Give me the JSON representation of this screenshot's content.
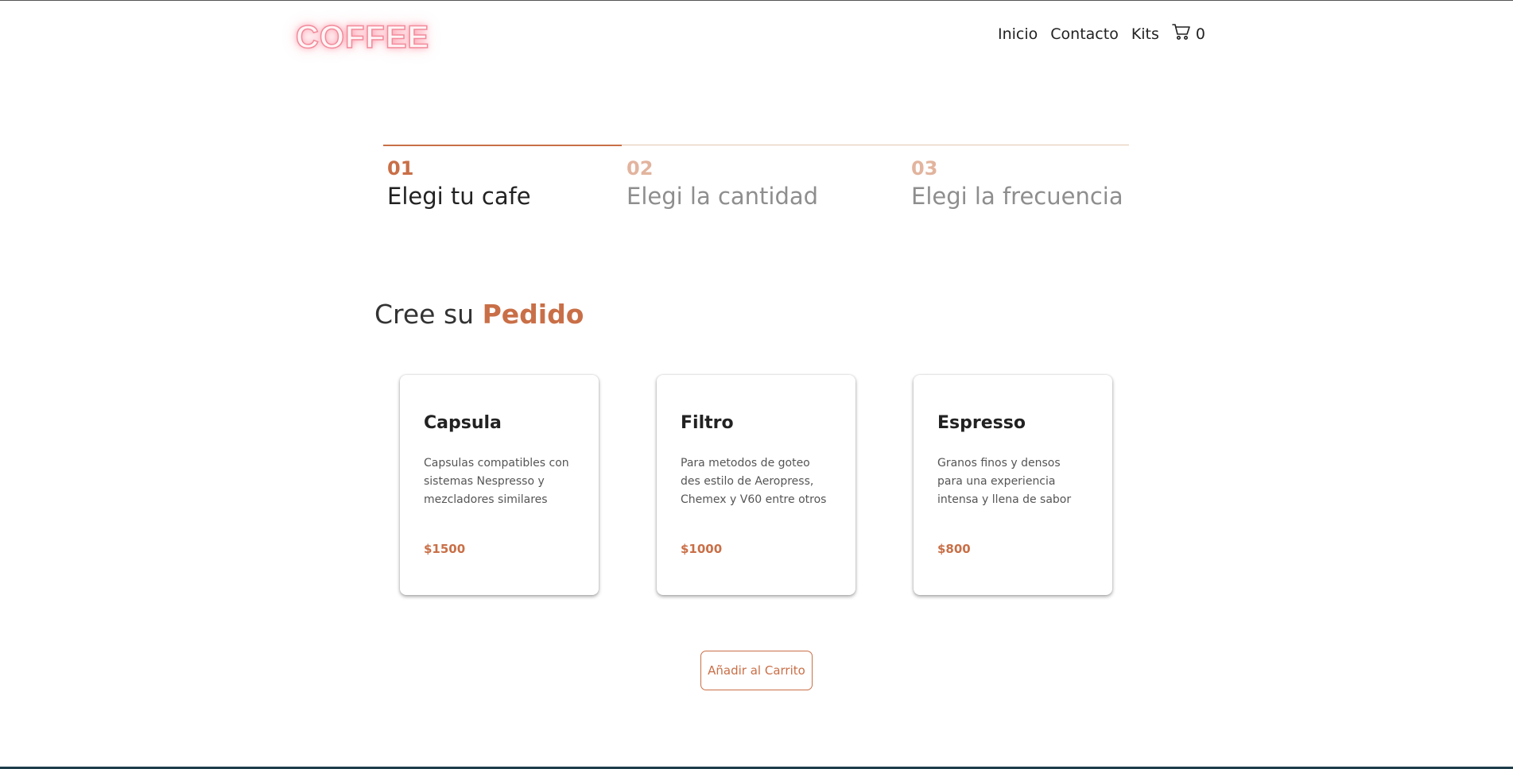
{
  "header": {
    "logo_text": "COFFEE",
    "nav": {
      "inicio": "Inicio",
      "contacto": "Contacto",
      "kits": "Kits",
      "cart_count": "0"
    }
  },
  "steps": [
    {
      "number": "01",
      "label": "Elegi tu cafe",
      "active": true
    },
    {
      "number": "02",
      "label": "Elegi la cantidad",
      "active": false
    },
    {
      "number": "03",
      "label": "Elegi la frecuencia",
      "active": false
    }
  ],
  "heading": {
    "prefix": "Cree su",
    "accent": "Pedido"
  },
  "cards": [
    {
      "title": "Capsula",
      "description": "Capsulas compatibles con sistemas Nespresso y mezcladores similares",
      "price": "$1500"
    },
    {
      "title": "Filtro",
      "description": "Para metodos de goteo des estilo de Aeropress, Chemex y V60 entre otros",
      "price": "$1000"
    },
    {
      "title": "Espresso",
      "description": "Granos finos y densos para una experiencia intensa y llena de sabor",
      "price": "$800"
    }
  ],
  "button": {
    "add_to_cart": "Añadir al Carrito"
  },
  "colors": {
    "accent": "#c96f47",
    "accent_light": "#e2b49e",
    "logo_neon": "#f28b9b",
    "footer_bar": "#1e3d4a"
  },
  "icons": {
    "cart": "shopping-cart-icon"
  }
}
